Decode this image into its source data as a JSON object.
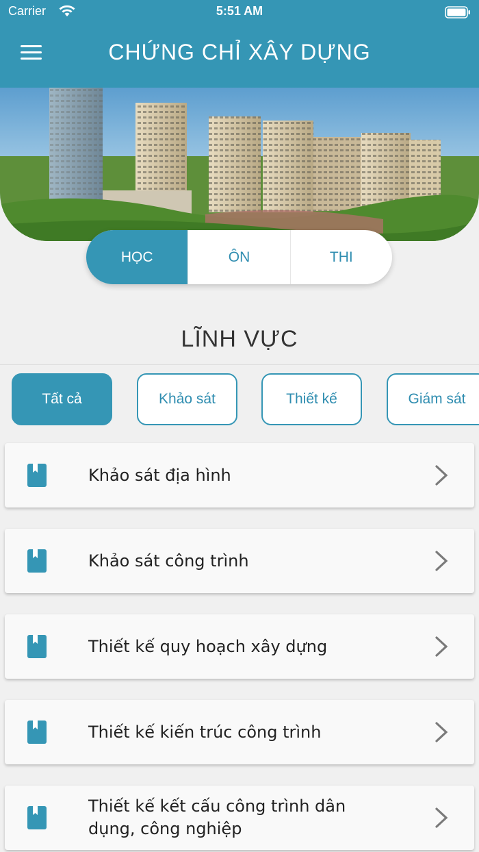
{
  "status": {
    "carrier": "Carrier",
    "time": "5:51 AM"
  },
  "header": {
    "title": "CHỨNG CHỈ XÂY DỰNG",
    "menu_icon": "hamburger-icon"
  },
  "tabs": [
    {
      "label": "HỌC",
      "active": true
    },
    {
      "label": "ÔN",
      "active": false
    },
    {
      "label": "THI",
      "active": false
    }
  ],
  "section": {
    "title": "LĨNH VỰC"
  },
  "chips": [
    {
      "label": "Tất cả",
      "active": true
    },
    {
      "label": "Khảo sát",
      "active": false
    },
    {
      "label": "Thiết kế",
      "active": false
    },
    {
      "label": "Giám sát",
      "active": false
    }
  ],
  "items": [
    {
      "label": "Khảo sát địa hình",
      "icon": "book-icon"
    },
    {
      "label": "Khảo sát công trình",
      "icon": "book-icon"
    },
    {
      "label": "Thiết kế quy hoạch xây dựng",
      "icon": "book-icon"
    },
    {
      "label": "Thiết kế kiến trúc công trình",
      "icon": "book-icon"
    },
    {
      "label": "Thiết kế kết cấu công trình dân dụng, công nghiệp",
      "icon": "book-icon"
    }
  ],
  "colors": {
    "primary": "#3596b5",
    "background": "#f0f0f0",
    "card": "#f9f9f9"
  }
}
